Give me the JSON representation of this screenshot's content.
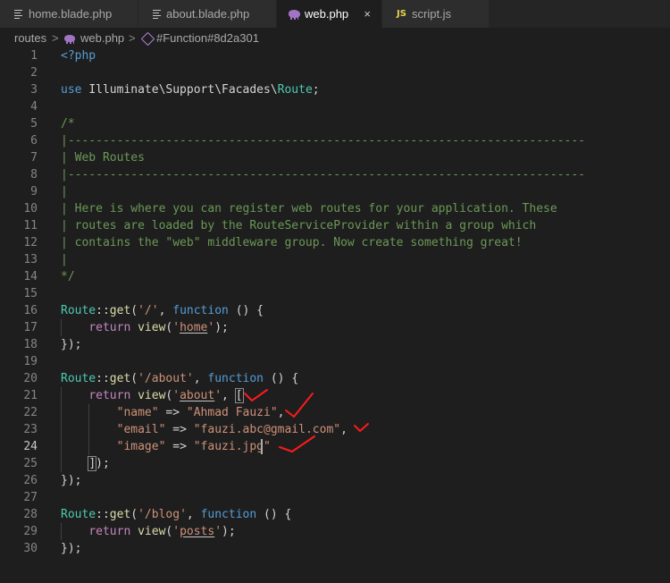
{
  "tabs": [
    {
      "label": "home.blade.php",
      "icon": "file-lines-icon",
      "active": false
    },
    {
      "label": "about.blade.php",
      "icon": "file-lines-icon",
      "active": false
    },
    {
      "label": "web.php",
      "icon": "php-elephant-icon",
      "active": true
    },
    {
      "label": "script.js",
      "icon": "js-icon",
      "active": false
    }
  ],
  "tab_close_glyph": "×",
  "js_icon_text": "JS",
  "breadcrumb": {
    "folder": "routes",
    "separator": ">",
    "file": "web.php",
    "symbol": "#Function#8d2a301"
  },
  "editor": {
    "current_line": 24,
    "line_numbers": [
      "1",
      "2",
      "3",
      "4",
      "5",
      "6",
      "7",
      "8",
      "9",
      "10",
      "11",
      "12",
      "13",
      "14",
      "15",
      "16",
      "17",
      "18",
      "19",
      "20",
      "21",
      "22",
      "23",
      "24",
      "25",
      "26",
      "27",
      "28",
      "29",
      "30"
    ],
    "lines": {
      "l1": "<?php",
      "l3": {
        "a": "use ",
        "b": "Illuminate\\Support\\Facades\\",
        "c": "Route",
        "d": ";"
      },
      "l5": "/*",
      "l6": "|--------------------------------------------------------------------------",
      "l7": "| Web Routes",
      "l8": "|--------------------------------------------------------------------------",
      "l9": "|",
      "l10": "| Here is where you can register web routes for your application. These",
      "l11": "| routes are loaded by the RouteServiceProvider within a group which",
      "l12": "| contains the \"web\" middleware group. Now create something great!",
      "l13": "|",
      "l14": "*/",
      "l16": {
        "cls": "Route",
        "op": "::",
        "fn": "get",
        "p1": "(",
        "s": "'/'",
        "p2": ", ",
        "kw": "function",
        "p3": " () {"
      },
      "l17": {
        "kw": "return",
        "fn": "view",
        "p1": "(",
        "q1": "'",
        "s": "home",
        "q2": "'",
        "p2": ");"
      },
      "l18": "});",
      "l20": {
        "cls": "Route",
        "op": "::",
        "fn": "get",
        "p1": "(",
        "s": "'/about'",
        "p2": ", ",
        "kw": "function",
        "p3": " () {"
      },
      "l21": {
        "kw": "return",
        "fn": "view",
        "p1": "(",
        "q1": "'",
        "s": "about",
        "q2": "'",
        "p2": ", ",
        "br": "["
      },
      "l22": {
        "k": "\"name\"",
        "op": " => ",
        "v": "\"Ahmad Fauzi\"",
        "c": ","
      },
      "l23": {
        "k": "\"email\"",
        "op": " => ",
        "v": "\"fauzi.abc@gmail.com\"",
        "c": ","
      },
      "l24": {
        "k": "\"image\"",
        "op": " => ",
        "v1": "\"fauzi.jpg",
        "v2": "\""
      },
      "l25": {
        "br": "]",
        "p": ");"
      },
      "l26": "});",
      "l28": {
        "cls": "Route",
        "op": "::",
        "fn": "get",
        "p1": "(",
        "s": "'/blog'",
        "p2": ", ",
        "kw": "function",
        "p3": " () {"
      },
      "l29": {
        "kw": "return",
        "fn": "view",
        "p1": "(",
        "q1": "'",
        "s": "posts",
        "q2": "'",
        "p2": ");"
      },
      "l30": "});"
    }
  },
  "colors": {
    "background": "#1e1e1e",
    "tabbar": "#252526",
    "keyword": "#569cd6",
    "class": "#4ec9b0",
    "function": "#dcdcaa",
    "string": "#ce9178",
    "comment": "#6a9955",
    "php_tag": "#569cd6",
    "annotation_marks": "#ff1a1a"
  }
}
